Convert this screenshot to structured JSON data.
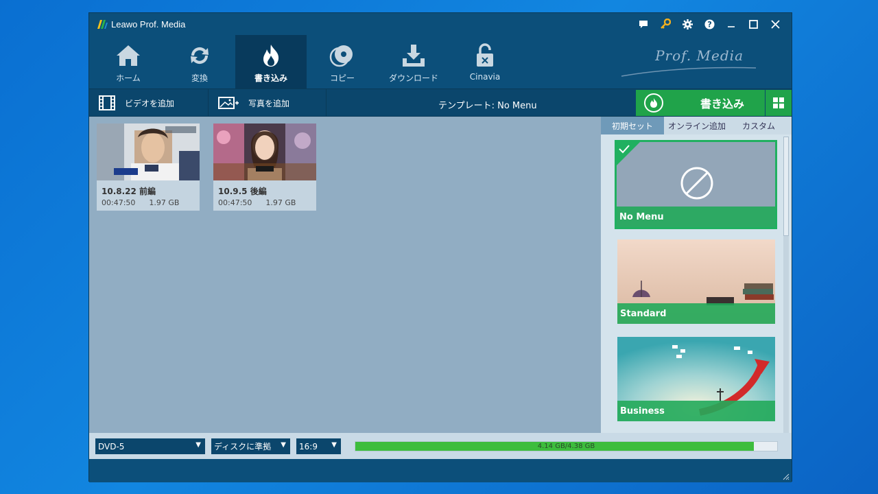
{
  "window": {
    "title": "Leawo Prof. Media",
    "brand": "Prof. Media"
  },
  "titlebar_icons": [
    "chat-icon",
    "key-icon",
    "gear-icon",
    "help-icon",
    "minimize-icon",
    "maximize-icon",
    "close-icon"
  ],
  "nav": {
    "items": [
      {
        "label": "ホーム",
        "icon": "home-icon",
        "active": false
      },
      {
        "label": "変換",
        "icon": "convert-icon",
        "active": false
      },
      {
        "label": "書き込み",
        "icon": "burn-icon",
        "active": true
      },
      {
        "label": "コピー",
        "icon": "disc-copy-icon",
        "active": false
      },
      {
        "label": "ダウンロード",
        "icon": "download-icon",
        "active": false
      },
      {
        "label": "Cinavia",
        "icon": "unlock-icon",
        "active": false
      }
    ]
  },
  "toolbar": {
    "add_video": "ビデオを追加",
    "add_photo": "写真を追加",
    "template": "テンプレート: No Menu",
    "burn": "書き込み"
  },
  "videos": [
    {
      "title": "10.8.22 前編",
      "duration": "00:47:50",
      "size": "1.97 GB"
    },
    {
      "title": "10.9.5 後編",
      "duration": "00:47:50",
      "size": "1.97 GB"
    }
  ],
  "sidebar": {
    "tabs": [
      {
        "label": "初期セット",
        "active": true
      },
      {
        "label": "オンライン追加",
        "active": false
      },
      {
        "label": "カスタム",
        "active": false
      }
    ],
    "templates": [
      {
        "label": "No Menu",
        "selected": true
      },
      {
        "label": "Standard",
        "selected": false
      },
      {
        "label": "Business",
        "selected": false
      }
    ]
  },
  "bottom": {
    "disc_type": "DVD-5",
    "quality": "ディスクに準拠",
    "aspect": "16:9",
    "capacity_text": "4.14 GB/4.38 GB",
    "capacity_fraction": 0.945
  },
  "colors": {
    "accent_green": "#20a34a",
    "nav_bg": "#0c4f7a",
    "content_bg": "#91adc3"
  }
}
